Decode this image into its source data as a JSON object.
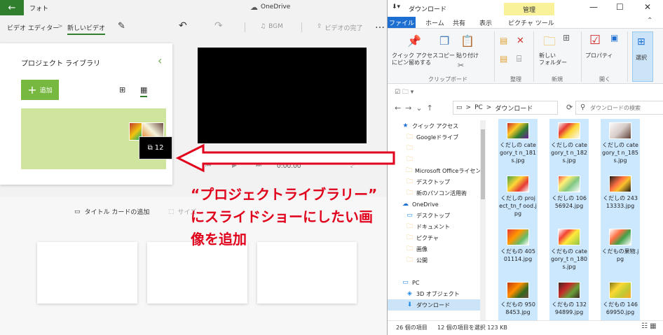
{
  "photos": {
    "app_name": "フォト",
    "onedrive_label": "OneDrive",
    "breadcrumb_editor": "ビデオ エディター",
    "breadcrumb_sep": ">",
    "breadcrumb_video": "新しいビデオ",
    "bgm_label": "BGM",
    "finish_label": "ビデオの完了",
    "library_title": "プロジェクト ライブラリ",
    "add_label": "追加",
    "drag_count": "12",
    "playback_time": "0:00.00",
    "add_title_card_label": "タイトル カードの追加",
    "resize_label": "サイズ"
  },
  "annotation": {
    "lines": [
      "“プロジェクトライブラリー”",
      "にスライドショーにしたい画",
      "像を追加"
    ],
    "color": "#e0001b"
  },
  "explorer": {
    "title": "ダウンロード",
    "manage_tab": "管理",
    "tabs": {
      "file": "ファイル",
      "home": "ホーム",
      "share": "共有",
      "view": "表示",
      "picture": "ピクチャ ツール"
    },
    "ribbon": {
      "pin_label": "クイック アクセス\nにピン留めする",
      "copy_label": "コピー",
      "paste_label": "貼り付け",
      "new_folder_label": "新しい\nフォルダー",
      "properties_label": "プロパティ",
      "selection_label": "選択",
      "groups": {
        "clipboard": "クリップボード",
        "organize": "整理",
        "new": "新規",
        "open": "開く"
      }
    },
    "address": {
      "pc": "PC",
      "sep": ">",
      "folder": "ダウンロード"
    },
    "search_placeholder": "ダウンロードの検索",
    "nav_items": [
      {
        "label": "クイック アクセス",
        "icon": "star-icon"
      },
      {
        "label": "Googleドライブ",
        "icon": "folder-icon"
      },
      {
        "label": "",
        "icon": "folder-icon"
      },
      {
        "label": "",
        "icon": "folder-icon"
      },
      {
        "label": "Microsoft Officeライセンス",
        "icon": "folder-icon"
      },
      {
        "label": "デスクトップ",
        "icon": "folder-icon"
      },
      {
        "label": "新のパソコン活用術",
        "icon": "folder-icon"
      },
      {
        "label": "OneDrive",
        "icon": "cloud-icon"
      },
      {
        "label": "デスクトップ",
        "icon": "desktop-icon"
      },
      {
        "label": "ドキュメント",
        "icon": "folder-icon"
      },
      {
        "label": "ピクチャ",
        "icon": "folder-icon"
      },
      {
        "label": "画像",
        "icon": "folder-icon"
      },
      {
        "label": "公開",
        "icon": "folder-icon"
      },
      {
        "label": "",
        "icon": ""
      },
      {
        "label": "PC",
        "icon": "pc-icon"
      },
      {
        "label": "3D オブジェクト",
        "icon": "cube-icon"
      },
      {
        "label": "ダウンロード",
        "icon": "download-icon"
      }
    ],
    "files": [
      {
        "name": "くだしの category_t n_181s.jpg",
        "thumb": "linear-gradient(135deg,#c62828,#ffca28 35%,#2e7d32 65%,#6a1b9a)"
      },
      {
        "name": "くだしの category_t n_182s.jpg",
        "thumb": "linear-gradient(135deg,#f5f5f5,#e53935 30%,#fdd835 55%,#fafafa)"
      },
      {
        "name": "くだしの category_t n_185s.jpg",
        "thumb": "linear-gradient(135deg,#fafafa,#d7ccc8 50%,#5d4037)"
      },
      {
        "name": "くだしの project_tn_f ood.jpg",
        "thumb": "linear-gradient(135deg,#43a047,#fdd835 40%,#e53935 70%,#fafafa)"
      },
      {
        "name": "くだしの 10656924.jpg",
        "thumb": "linear-gradient(135deg,#ef5350,#fff176 30%,#81c784 60%,#fff)"
      },
      {
        "name": "くだしの 24313333.jpg",
        "thumb": "linear-gradient(135deg,#1b1b1b,#ff7043 40%,#fbc02d 60%,#1b1b1b)"
      },
      {
        "name": "くだもの 40501114.jpg",
        "thumb": "linear-gradient(135deg,#e53935,#ff9800 40%,#66bb6a 70%,#fff)"
      },
      {
        "name": "くだもの category_t n_180s.jpg",
        "thumb": "linear-gradient(135deg,#fff,#f44336 30%,#ffeb3b 55%,#8bc34a)"
      },
      {
        "name": "くだもの果物.jpg",
        "thumb": "linear-gradient(135deg,#fff,#ff7043 35%,#43a047 60%,#fff)"
      },
      {
        "name": "くだもの 9508453.jpg",
        "thumb": "linear-gradient(135deg,#bf360c,#ff8f00 40%,#33691e 70%,#6d4c41)"
      },
      {
        "name": "くだもの 13294899.jpg",
        "thumb": "linear-gradient(135deg,#3e2723,#c62828 35%,#689f38 65%,#3e2723)"
      },
      {
        "name": "くだもの 14669950.jpg",
        "thumb": "linear-gradient(135deg,#827717,#fdd835 35%,#c0ca33 65%,#f9a825)"
      }
    ],
    "status_count": "26 個の項目",
    "status_selected": "12 個の項目を選択  123 KB"
  }
}
